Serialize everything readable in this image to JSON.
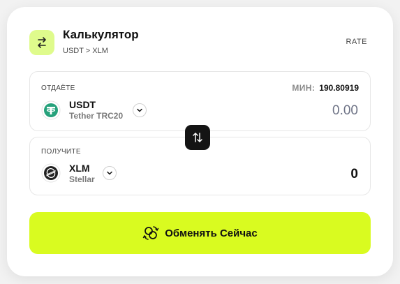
{
  "header": {
    "title": "Калькулятор",
    "pair": "USDT > XLM",
    "rate_label": "RATE",
    "icon": "arrows-left-right-icon"
  },
  "give": {
    "label": "ОТДАЁТЕ",
    "min_label": "МИН:",
    "min_value": "190.80919",
    "coin_code": "USDT",
    "coin_network": "Tether TRC20",
    "coin_icon": "tether-icon",
    "amount": "0.00"
  },
  "get": {
    "label": "ПОЛУЧИТЕ",
    "coin_code": "XLM",
    "coin_network": "Stellar",
    "coin_icon": "stellar-icon",
    "amount": "0"
  },
  "swap": {
    "icon": "swap-vertical-icon"
  },
  "exchange": {
    "label": "Обменять Сейчас",
    "icon": "exchange-coins-icon"
  },
  "colors": {
    "accent": "#d9fb20",
    "header_icon_bg": "#dffb8c",
    "swap_bg": "#141414",
    "tether": "#26a17b"
  }
}
